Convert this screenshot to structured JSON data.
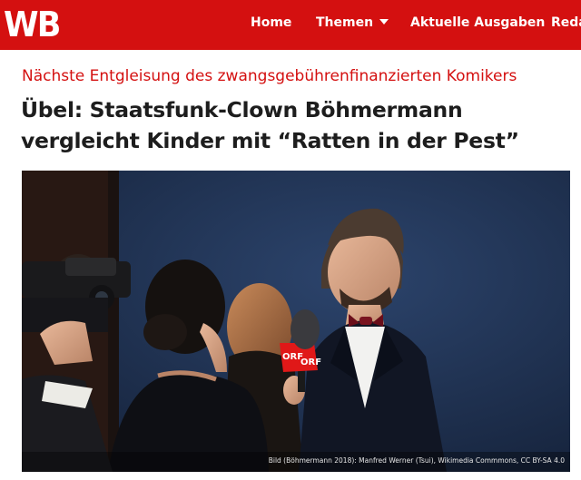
{
  "site": {
    "logo": "WB"
  },
  "nav": {
    "items": [
      {
        "label": "Home"
      },
      {
        "label": "Themen",
        "has_dropdown": true
      },
      {
        "label": "Aktuelle Ausgaben"
      },
      {
        "label": "Reda"
      }
    ]
  },
  "article": {
    "kicker": "Nächste Entgleisung des zwangsgebührenfinanzierten Komikers",
    "headline_line1": "Übel: Staatsfunk-Clown Böhmermann",
    "headline_line2": "vergleicht Kinder mit “Ratten in der Pest”",
    "image": {
      "subject": "man in tuxedo being interviewed with ORF microphone",
      "microphone_label": "ORF",
      "credit": "Bild (Böhmermann 2018): Manfred Werner (Tsui), Wikimedia Commmons, CC BY-SA 4.0"
    }
  },
  "colors": {
    "brand_red": "#d41010",
    "headline": "#1d1d1d",
    "background": "#ffffff"
  },
  "icons": {
    "dropdown": "chevron-down-icon"
  }
}
